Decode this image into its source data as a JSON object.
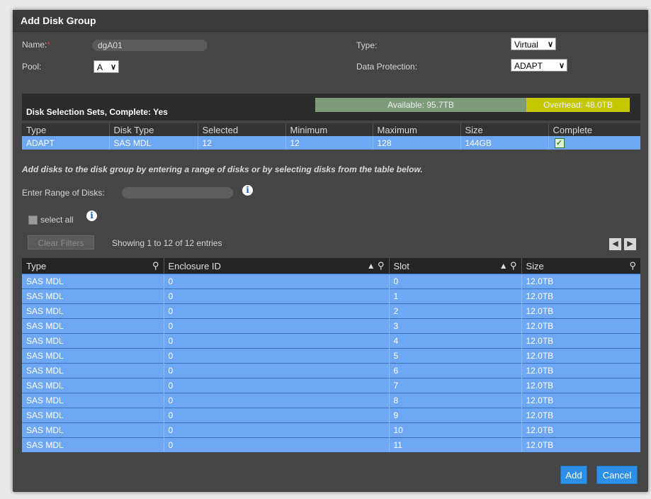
{
  "dialog": {
    "title": "Add Disk Group"
  },
  "form": {
    "name_label": "Name:",
    "required_mark": "*",
    "name_value": "dgA01",
    "type_label": "Type:",
    "type_value": "Virtual",
    "pool_label": "Pool:",
    "pool_value": "A",
    "protection_label": "Data Protection:",
    "protection_value": "ADAPT"
  },
  "selection": {
    "title": "Disk Selection Sets, Complete: Yes",
    "available": "Available: 95.7TB",
    "overhead": "Overhead: 48.0TB",
    "available_color": "#7d9a7a",
    "overhead_color": "#c4c800",
    "columns": [
      "Type",
      "Disk Type",
      "Selected",
      "Minimum",
      "Maximum",
      "Size",
      "Complete"
    ],
    "row": {
      "type": "ADAPT",
      "disk_type": "SAS MDL",
      "selected": "12",
      "minimum": "12",
      "maximum": "128",
      "size": "144GB",
      "complete": true
    }
  },
  "instruction": "Add disks to the disk group by entering a range of disks or by selecting disks from the table below.",
  "range": {
    "label": "Enter Range of Disks:",
    "value": ""
  },
  "select_all_label": "select all",
  "clear_filters": "Clear Filters",
  "showing": "Showing 1 to 12 of 12 entries",
  "disk_table": {
    "columns": [
      "Type",
      "Enclosure ID",
      "Slot",
      "Size"
    ],
    "rows": [
      [
        "SAS MDL",
        "0",
        "0",
        "12.0TB"
      ],
      [
        "SAS MDL",
        "0",
        "1",
        "12.0TB"
      ],
      [
        "SAS MDL",
        "0",
        "2",
        "12.0TB"
      ],
      [
        "SAS MDL",
        "0",
        "3",
        "12.0TB"
      ],
      [
        "SAS MDL",
        "0",
        "4",
        "12.0TB"
      ],
      [
        "SAS MDL",
        "0",
        "5",
        "12.0TB"
      ],
      [
        "SAS MDL",
        "0",
        "6",
        "12.0TB"
      ],
      [
        "SAS MDL",
        "0",
        "7",
        "12.0TB"
      ],
      [
        "SAS MDL",
        "0",
        "8",
        "12.0TB"
      ],
      [
        "SAS MDL",
        "0",
        "9",
        "12.0TB"
      ],
      [
        "SAS MDL",
        "0",
        "10",
        "12.0TB"
      ],
      [
        "SAS MDL",
        "0",
        "11",
        "12.0TB"
      ]
    ]
  },
  "buttons": {
    "add": "Add",
    "cancel": "Cancel"
  },
  "accent_color": "#2e8fe6",
  "row_color": "#6ea8f5"
}
